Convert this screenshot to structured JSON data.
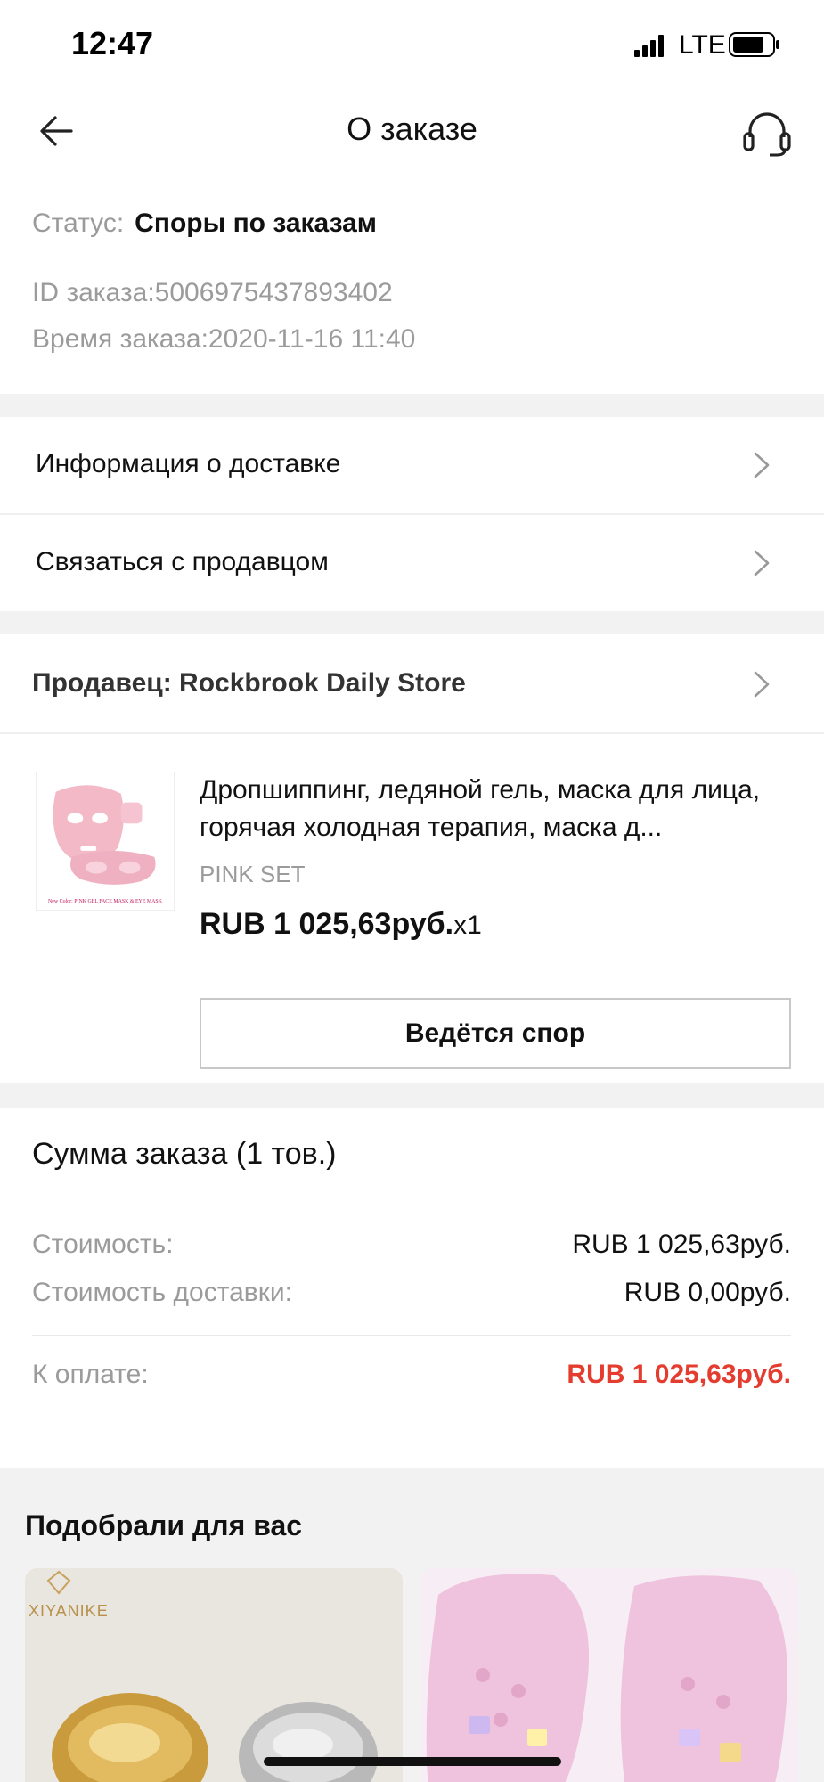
{
  "status_bar": {
    "time": "12:47",
    "network": "LTE",
    "icons": [
      "signal-icon",
      "battery-icon"
    ]
  },
  "nav": {
    "title": "О заказе",
    "icons": [
      "back-arrow-icon",
      "headset-icon"
    ]
  },
  "order": {
    "status_label": "Статус:",
    "status_value": "Споры по заказам",
    "id_text": "ID заказа:5006975437893402",
    "time_text": "Время заказа:2020-11-16 11:40"
  },
  "menu": {
    "delivery_info": "Информация о доставке",
    "contact_seller": "Связаться с продавцом"
  },
  "seller": {
    "label": "Продавец: Rockbrook Daily Store"
  },
  "product": {
    "name": "Дропшиппинг, ледяной гель, маска для лица, горячая холодная терапия, маска д...",
    "variant": "PINK SET",
    "price": "RUB 1 025,63руб.",
    "qty": "x1",
    "dispute_button": "Ведётся спор",
    "thumb_caption": "New Color: PINK GEL FACE MASK & EYE MASK"
  },
  "summary": {
    "title": "Сумма заказа (1 тов.)",
    "cost_label": "Стоимость:",
    "cost_value": "RUB 1 025,63руб.",
    "shipping_label": "Стоимость доставки:",
    "shipping_value": "RUB 0,00руб.",
    "total_label": "К оплате:",
    "total_value": "RUB 1 025,63руб."
  },
  "recommend": {
    "title": "Подобрали для вас",
    "card1_brand": "XIYANIKE"
  },
  "colors": {
    "accent_red": "#e43d2f",
    "muted_gray": "#9b9b9b",
    "section_gap": "#f2f2f2"
  }
}
